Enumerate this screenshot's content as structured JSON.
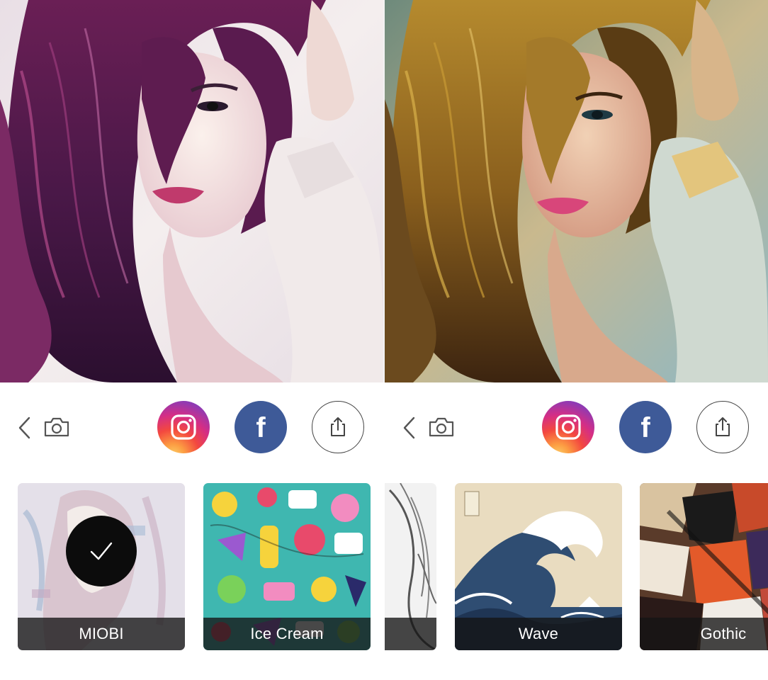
{
  "left_panel": {
    "photo": {
      "style": "pink-purple watercolor portrait"
    },
    "actions": {
      "back_icon": "chevron-left-icon",
      "camera_icon": "camera-icon",
      "instagram_icon": "instagram-icon",
      "facebook_label": "f",
      "share_icon": "share-icon"
    },
    "filters": [
      {
        "label": "MIOBI",
        "selected": true,
        "thumb": "pastel portrait"
      },
      {
        "label": "Ice Cream",
        "selected": false,
        "thumb": "teal doodle collage"
      }
    ]
  },
  "right_panel": {
    "photo": {
      "style": "golden painted portrait"
    },
    "actions": {
      "back_icon": "chevron-left-icon",
      "camera_icon": "camera-icon",
      "instagram_icon": "instagram-icon",
      "facebook_label": "f",
      "share_icon": "share-icon"
    },
    "filters": [
      {
        "label": "",
        "selected": false,
        "thumb": "sketch (partially visible)"
      },
      {
        "label": "Wave",
        "selected": false,
        "thumb": "great wave woodblock"
      },
      {
        "label": "Gothic",
        "selected": false,
        "thumb": "abstract shapes"
      }
    ]
  },
  "colors": {
    "instagram_gradient": [
      "#fdd269",
      "#f3483f",
      "#d42e86",
      "#5b50c8"
    ],
    "facebook_blue": "#3e5a98",
    "selected_check_bg": "#0c0c0c",
    "label_bar": "#141414"
  }
}
